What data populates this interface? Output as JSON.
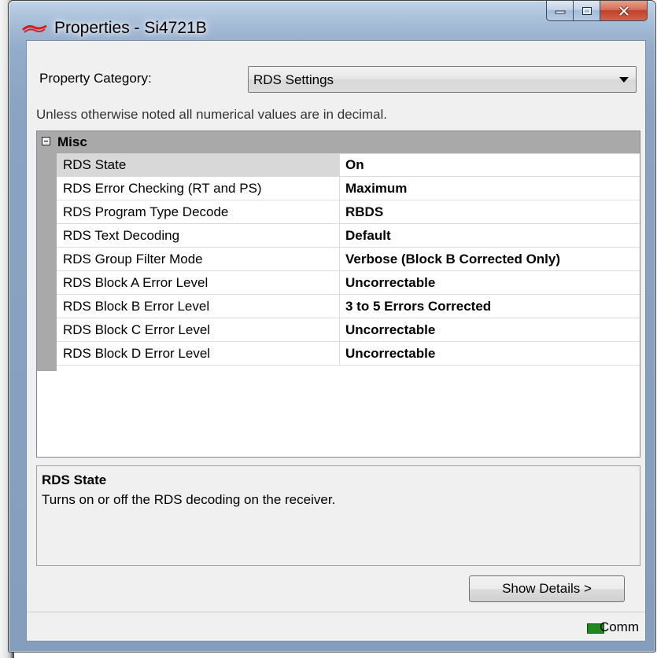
{
  "window": {
    "title": "Properties - Si4721B",
    "app_icon": "silicon-labs-logo-icon",
    "accent_color": "#a5bcd6"
  },
  "category": {
    "label": "Property Category:",
    "selected": "RDS Settings"
  },
  "note": "Unless otherwise noted all numerical values are in decimal.",
  "grid": {
    "category_title": "Misc",
    "properties": [
      {
        "name": "RDS State",
        "value": "On"
      },
      {
        "name": "RDS Error Checking (RT and PS)",
        "value": "Maximum"
      },
      {
        "name": "RDS Program Type Decode",
        "value": "RBDS"
      },
      {
        "name": "RDS Text Decoding",
        "value": "Default"
      },
      {
        "name": "RDS Group Filter Mode",
        "value": "Verbose (Block B Corrected Only)"
      },
      {
        "name": "RDS Block A Error Level",
        "value": "Uncorrectable"
      },
      {
        "name": "RDS Block B Error Level",
        "value": "3 to 5 Errors Corrected"
      },
      {
        "name": "RDS Block C Error Level",
        "value": "Uncorrectable"
      },
      {
        "name": "RDS Block D Error Level",
        "value": "Uncorrectable"
      }
    ]
  },
  "help": {
    "title": "RDS State",
    "description": "Turns on or off the RDS decoding on the receiver."
  },
  "buttons": {
    "show_details": "Show Details >"
  },
  "status": {
    "comm_label": "Comm",
    "comm_color": "#1e8a1e"
  }
}
